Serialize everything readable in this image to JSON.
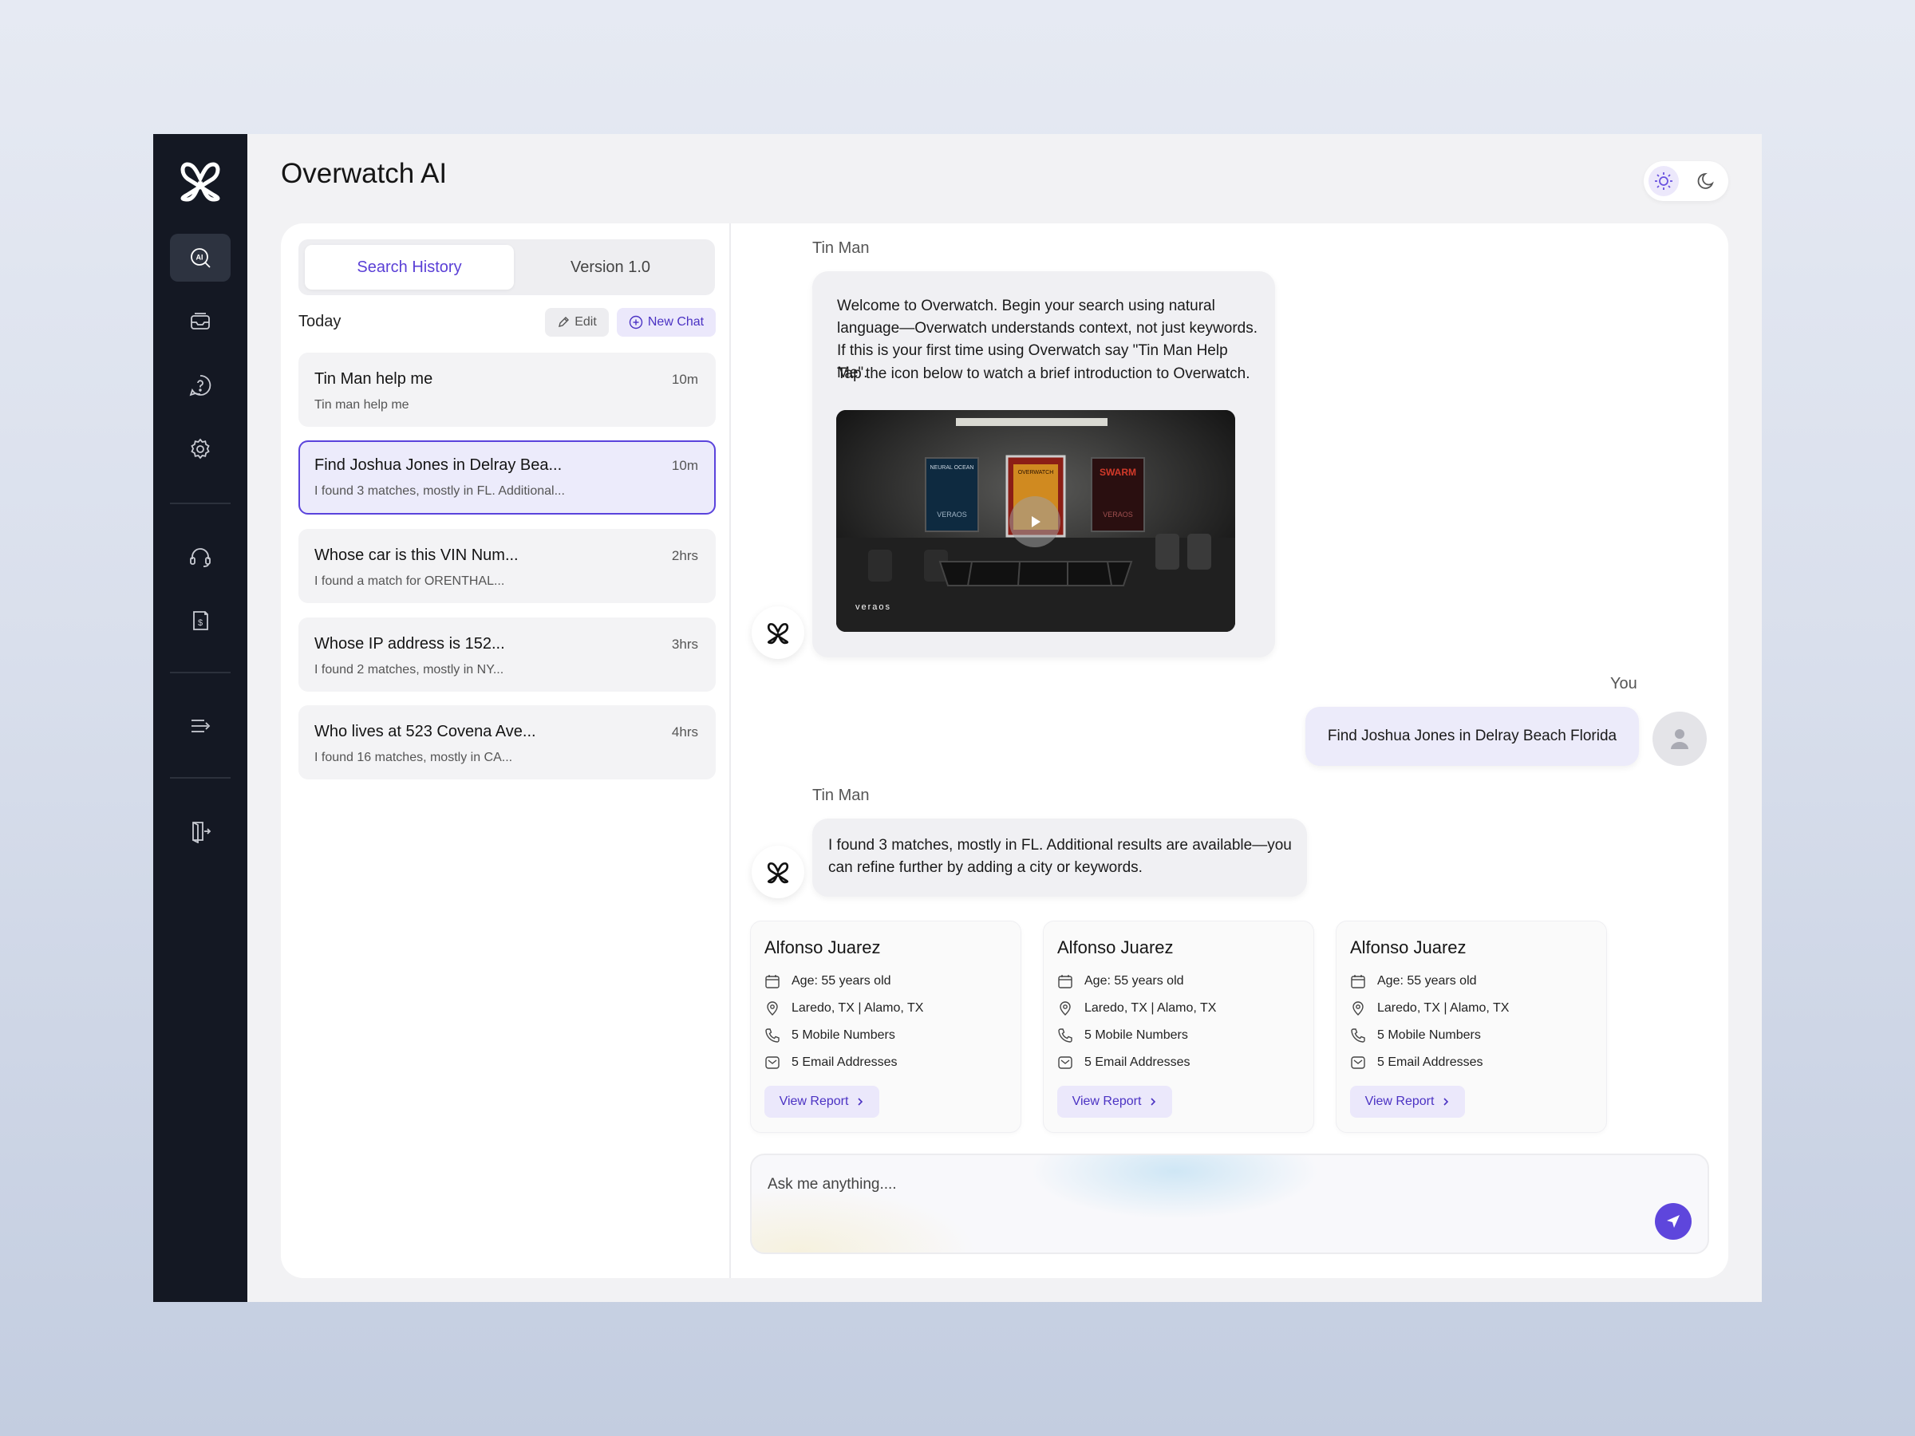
{
  "app": {
    "title": "Overwatch AI"
  },
  "sidebar": {
    "items": [
      {
        "icon": "ai-search-icon",
        "active": true
      },
      {
        "icon": "inbox-icon"
      },
      {
        "icon": "help-icon"
      },
      {
        "icon": "gear-icon"
      },
      {
        "icon": "headset-icon"
      },
      {
        "icon": "billing-icon"
      },
      {
        "icon": "menu-icon"
      },
      {
        "icon": "logout-icon"
      }
    ]
  },
  "tabs": {
    "active": "Search History",
    "inactive": "Version 1.0"
  },
  "history": {
    "section": "Today",
    "edit_label": "Edit",
    "new_chat_label": "New Chat",
    "items": [
      {
        "title": "Tin Man help me",
        "time": "10m",
        "subtitle": "Tin man help me"
      },
      {
        "title": "Find Joshua Jones in Delray Bea...",
        "time": "10m",
        "subtitle": "I found 3 matches, mostly in FL. Additional..."
      },
      {
        "title": "Whose car is this VIN Num...",
        "time": "2hrs",
        "subtitle": "I found a match for ORENTHAL..."
      },
      {
        "title": "Whose IP address is 152...",
        "time": "3hrs",
        "subtitle": "I found 2 matches, mostly in NY..."
      },
      {
        "title": "Who lives at 523 Covena Ave...",
        "time": "4hrs",
        "subtitle": "I found 16 matches, mostly in CA..."
      }
    ]
  },
  "chat": {
    "bot_name": "Tin Man",
    "user_name": "You",
    "welcome_p1": "Welcome to Overwatch. Begin your search using natural language—Overwatch understands context, not just keywords. If this is your first time using Overwatch say \"Tin Man Help Me\".",
    "welcome_p2": "Tap the icon below to watch a brief introduction to Overwatch.",
    "video": {
      "poster_left_title": "NEURAL OCEAN",
      "poster_left_brand": "VERAOS",
      "poster_center_title": "OVERWATCH",
      "poster_right_title": "SWARM",
      "poster_right_brand": "VERAOS",
      "brand": "veraos"
    },
    "user_message": "Find Joshua Jones in Delray Beach Florida",
    "bot_reply": "I found 3 matches, mostly in FL. Additional results are available—you can refine further by adding a city or keywords.",
    "results": [
      {
        "name": "Alfonso Juarez",
        "age": "Age: 55 years old",
        "location": "Laredo, TX | Alamo, TX",
        "phones": "5 Mobile Numbers",
        "emails": "5 Email Addresses",
        "action": "View Report"
      },
      {
        "name": "Alfonso Juarez",
        "age": "Age: 55 years old",
        "location": "Laredo, TX | Alamo, TX",
        "phones": "5 Mobile Numbers",
        "emails": "5 Email Addresses",
        "action": "View Report"
      },
      {
        "name": "Alfonso Juarez",
        "age": "Age: 55 years old",
        "location": "Laredo, TX | Alamo, TX",
        "phones": "5 Mobile Numbers",
        "emails": "5 Email Addresses",
        "action": "View Report"
      }
    ]
  },
  "composer": {
    "placeholder": "Ask me anything...."
  },
  "colors": {
    "sidebar": "#141823",
    "accent": "#5e46dc",
    "accent_text": "#4b32c3",
    "accent_soft": "#ebe8fb"
  }
}
